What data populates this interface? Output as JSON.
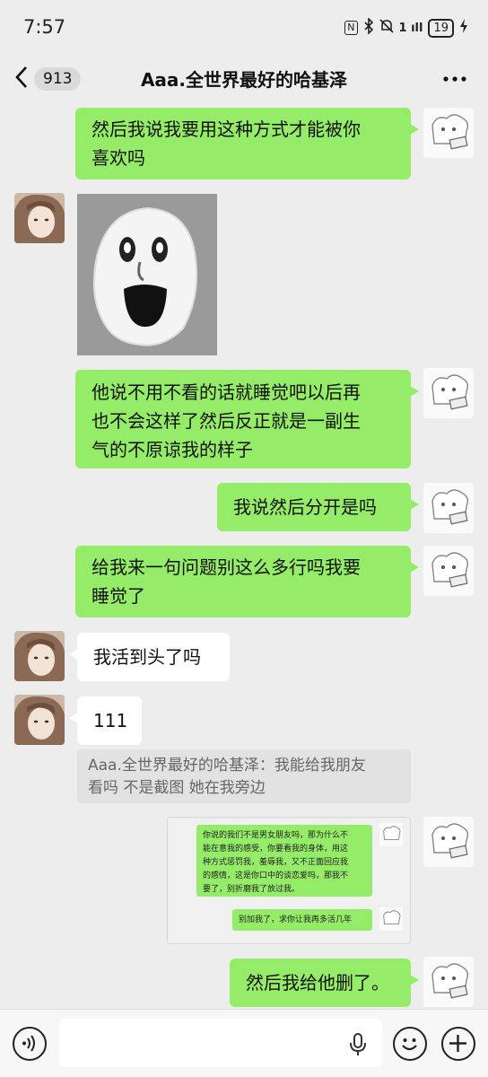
{
  "status_bar": {
    "time": "7:57",
    "network_badge": "N",
    "signal_text": "1 ıll",
    "battery": "19"
  },
  "header": {
    "back_count": "913",
    "title": "Aaa.全世界最好的哈基泽",
    "more_icon": "more-dots-icon"
  },
  "messages": [
    {
      "side": "right",
      "type": "text",
      "lines": [
        "然后我说我要用这种方式才能被你",
        "喜欢吗"
      ]
    },
    {
      "side": "left",
      "type": "sticker",
      "icon": "laughing-blob-sticker"
    },
    {
      "side": "right",
      "type": "text",
      "lines": [
        "他说不用不看的话就睡觉吧以后再",
        "也不会这样了然后反正就是一副生",
        "气的不原谅我的样子"
      ]
    },
    {
      "side": "right",
      "type": "text",
      "lines": [
        "我说然后分开是吗"
      ]
    },
    {
      "side": "right",
      "type": "text",
      "lines": [
        "给我来一句问题别这么多行吗我要",
        "睡觉了"
      ]
    },
    {
      "side": "left",
      "type": "text",
      "lines": [
        "我活到头了吗"
      ]
    },
    {
      "side": "left",
      "type": "text",
      "lines": [
        "111"
      ]
    },
    {
      "side": "left",
      "type": "quote",
      "lines": [
        "Aaa.全世界最好的哈基泽：我能给我朋友",
        "看吗 不是截图 她在我旁边"
      ]
    },
    {
      "side": "right",
      "type": "screenshot",
      "inner": [
        {
          "lines": [
            "你说的我们不是男女朋友吗，那为什么不",
            "能在意我的感受，你要看我的身体，用这",
            "种方式惩罚我，羞辱我，又不正面回应我",
            "的感情，这是你口中的谈恋爱吗，那我不",
            "要了，别折磨我了放过我。"
          ]
        },
        {
          "lines": [
            "别加我了，求你让我再多活几年"
          ]
        }
      ]
    },
    {
      "side": "right",
      "type": "text",
      "lines": [
        "然后我给他删了。"
      ]
    }
  ],
  "input_bar": {
    "placeholder": "",
    "voice_icon": "voice-icon",
    "emoji_icon": "emoji-icon",
    "plus_icon": "plus-icon",
    "mic_icon": "mic-icon"
  },
  "colors": {
    "background": "#ededed",
    "outgoing_bubble": "#95ec69",
    "incoming_bubble": "#ffffff",
    "quote_bg": "#e2e2e2"
  }
}
